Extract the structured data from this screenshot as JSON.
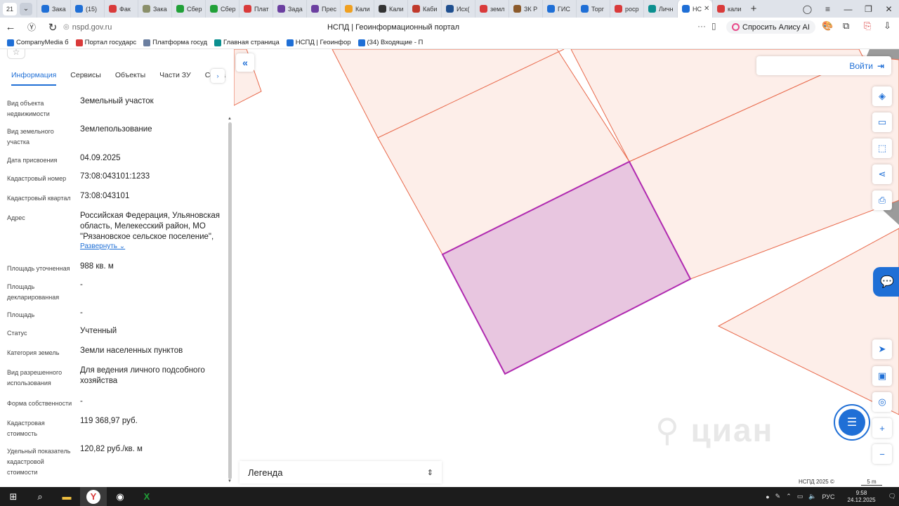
{
  "browser": {
    "tab_counter": "21",
    "tabs": [
      {
        "label": "Зака",
        "color": "#1f6fd6"
      },
      {
        "label": "(15)",
        "color": "#1f6fd6"
      },
      {
        "label": "Фак",
        "color": "#d93a3a"
      },
      {
        "label": "Зака",
        "color": "#8a8f6a"
      },
      {
        "label": "Сбер",
        "color": "#21a038"
      },
      {
        "label": "Сбер",
        "color": "#21a038"
      },
      {
        "label": "Плат",
        "color": "#d93a3a"
      },
      {
        "label": "Зада",
        "color": "#6b3fa0"
      },
      {
        "label": "Прес",
        "color": "#6b3fa0"
      },
      {
        "label": "Кали",
        "color": "#f0a020"
      },
      {
        "label": "Кали",
        "color": "#333333"
      },
      {
        "label": "Каби",
        "color": "#c0392b"
      },
      {
        "label": "Исх(",
        "color": "#1f4f8f"
      },
      {
        "label": "земл",
        "color": "#d93a3a"
      },
      {
        "label": "ЗК Р",
        "color": "#8b5a2b"
      },
      {
        "label": "ГИС",
        "color": "#1f6fd6"
      },
      {
        "label": "Торг",
        "color": "#1f6fd6"
      },
      {
        "label": "роср",
        "color": "#d93a3a"
      },
      {
        "label": "Личн",
        "color": "#0b8f8f"
      },
      {
        "label": "НС",
        "color": "#1f6fd6",
        "active": true
      },
      {
        "label": "кали",
        "color": "#d93a3a"
      }
    ],
    "url": "nspd.gov.ru",
    "page_title": "НСПД | Геоинформационный портал",
    "alice_label": "Спросить Алису AI",
    "bookmarks": [
      {
        "label": "CompanyMedia б",
        "color": "#1f6fd6"
      },
      {
        "label": "Портал государс",
        "color": "#d93a3a"
      },
      {
        "label": "Платформа госуд",
        "color": "#6b7fa0"
      },
      {
        "label": "Главная страница",
        "color": "#0b8f8f"
      },
      {
        "label": "НСПД | Геоинфор",
        "color": "#1f6fd6"
      },
      {
        "label": "(34) Входящие - П",
        "color": "#1f6fd6"
      }
    ]
  },
  "panel": {
    "tabs": [
      "Информация",
      "Сервисы",
      "Объекты",
      "Части ЗУ",
      "Соста"
    ],
    "active_tab": "Информация",
    "fields": [
      {
        "label": "Вид объекта недвижимости",
        "value": "Земельный участок"
      },
      {
        "label": "Вид земельного участка",
        "value": "Землепользование"
      },
      {
        "label": "Дата присвоения",
        "value": "04.09.2025"
      },
      {
        "label": "Кадастровый номер",
        "value": "73:08:043101:1233"
      },
      {
        "label": "Кадастровый квартал",
        "value": "73:08:043101"
      },
      {
        "label": "Адрес",
        "value": "Российская Федерация, Ульяновская область, Мелекесский район, МО \"Рязановское сельское поселение\","
      },
      {
        "label": "Площадь уточненная",
        "value": "988 кв. м"
      },
      {
        "label": "Площадь декларированная",
        "value": "-"
      },
      {
        "label": "Площадь",
        "value": "-"
      },
      {
        "label": "Статус",
        "value": "Учтенный"
      },
      {
        "label": "Категория земель",
        "value": "Земли населенных пунктов"
      },
      {
        "label": "Вид разрешенного использования",
        "value": "Для ведения личного подсобного хозяйства"
      },
      {
        "label": "Форма собственности",
        "value": "-"
      },
      {
        "label": "Кадастровая стоимость",
        "value": "119 368,97 руб."
      },
      {
        "label": "Удельный показатель кадастровой стоимости",
        "value": "120,82 руб./кв. м"
      }
    ],
    "expand_label": "Развернуть"
  },
  "map": {
    "login_label": "Войти",
    "legend_label": "Легенда",
    "copyright": "НСПД 2025 ©",
    "scale": "5 m",
    "parcel_fill": "#e8c6e0",
    "parcel_stroke": "#b02ab0",
    "plot_fill": "#fdeee9",
    "plot_stroke": "#e8684a"
  },
  "taskbar": {
    "lang": "РУС",
    "time": "9:58",
    "date": "24.12.2025"
  }
}
